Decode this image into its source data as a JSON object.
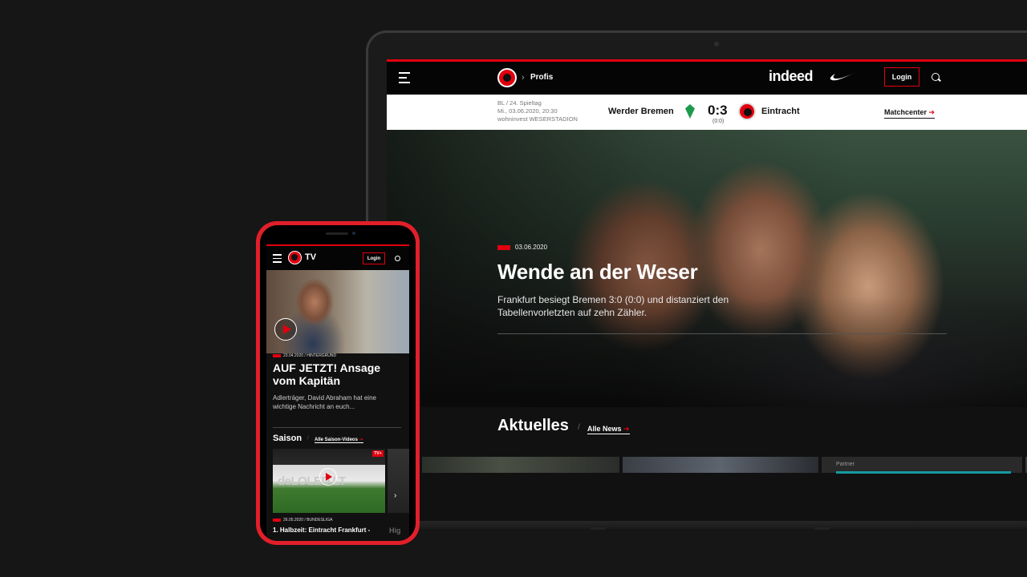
{
  "laptop": {
    "nav": {
      "breadcrumb": "Profis",
      "sponsor": "indeed",
      "login": "Login"
    },
    "match": {
      "competition": "BL / 24. Spieltag",
      "datetime": "Mi., 03.06.2020, 20:30",
      "venue": "wohninvest WESERSTADION",
      "home": "Werder Bremen",
      "score": "0:3",
      "halftime": "(0:0)",
      "away": "Eintracht",
      "matchcenter": "Matchcenter"
    },
    "hero": {
      "date": "03.06.2020",
      "title": "Wende an der Weser",
      "subtitle": "Frankfurt besiegt Bremen 3:0 (0:0) und distanziert den Tabellenvorletzten auf zehn Zähler."
    },
    "news": {
      "heading": "Aktuelles",
      "all_link": "Alle News",
      "partner": "Partner"
    }
  },
  "phone": {
    "nav": {
      "brand": "TV",
      "login": "Login"
    },
    "feature": {
      "kicker": "23.04.2020 / HINTERGRUND",
      "title": "AUF JETZT! Ansage vom Kapitän",
      "teaser": "Adlerträger, David Abraham hat eine wichtige Nachricht an euch..."
    },
    "season": {
      "heading": "Saison",
      "all_link": "Alle Saison-Videos",
      "badge": "TV+",
      "video_board": "deLOLED LT",
      "kicker": "26.05.2020 / BUNDESLIGA",
      "video_title": "1. Halbzeit: Eintracht Frankfurt -",
      "next_title": "Hig"
    }
  },
  "colors": {
    "accent": "#e1000f",
    "background": "#161616",
    "phone_frame": "#e11f2a",
    "werder": "#1d9a4b"
  },
  "icons": [
    "menu-icon",
    "eagle-crest-icon",
    "chevron-right-icon",
    "nike-swoosh-icon",
    "search-icon",
    "play-icon",
    "arrow-right-icon",
    "werder-crest-icon"
  ]
}
